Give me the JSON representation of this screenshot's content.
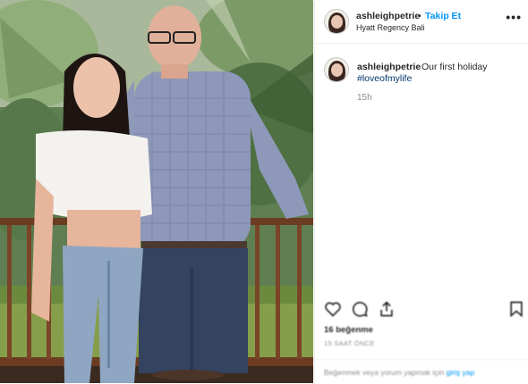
{
  "post": {
    "username": "ashleighpetrie",
    "separator": "•",
    "follow_label": "Takip Et",
    "location": "Hyatt Regency Bali",
    "more_label": "•••"
  },
  "caption": {
    "username": "ashleighpetrie",
    "text": "Our first holiday",
    "hashtag": "#loveofmylife",
    "time": "15h"
  },
  "actions": {
    "likes": "16 beğenme",
    "time_ago": "15 SAAT ÖNCE",
    "comment_prompt": "Beğenmek veya yorum yapmak için",
    "login_link": "giriş yap"
  },
  "icons": [
    "heart-icon",
    "comment-icon",
    "share-icon",
    "bookmark-icon"
  ],
  "colors": {
    "link": "#0095f6",
    "hashtag": "#00376b",
    "muted": "#8e8e8e"
  }
}
